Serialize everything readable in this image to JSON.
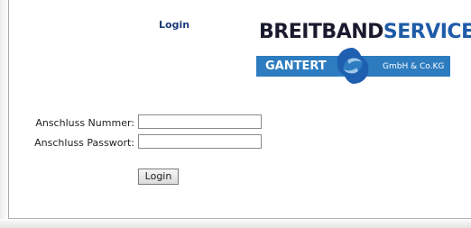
{
  "page": {
    "title": "Login"
  },
  "logo": {
    "wordmark_part_a": "BREITBAND",
    "wordmark_part_b": "SERVICE",
    "company_name": "GANTERT",
    "legal_form": "GmbH & Co.KG",
    "colors": {
      "dark": "#1a1a2e",
      "brand_blue": "#1f5ca8",
      "band_blue": "#2d7cc0",
      "emblem_blue": "#1e5fb0"
    }
  },
  "form": {
    "nummer_label": "Anschluss Nummer:",
    "nummer_value": "",
    "passwort_label": "Anschluss Passwort:",
    "passwort_value": "",
    "submit_label": "Login"
  },
  "icons": {
    "logo_emblem": "swirl-emblem-icon"
  }
}
